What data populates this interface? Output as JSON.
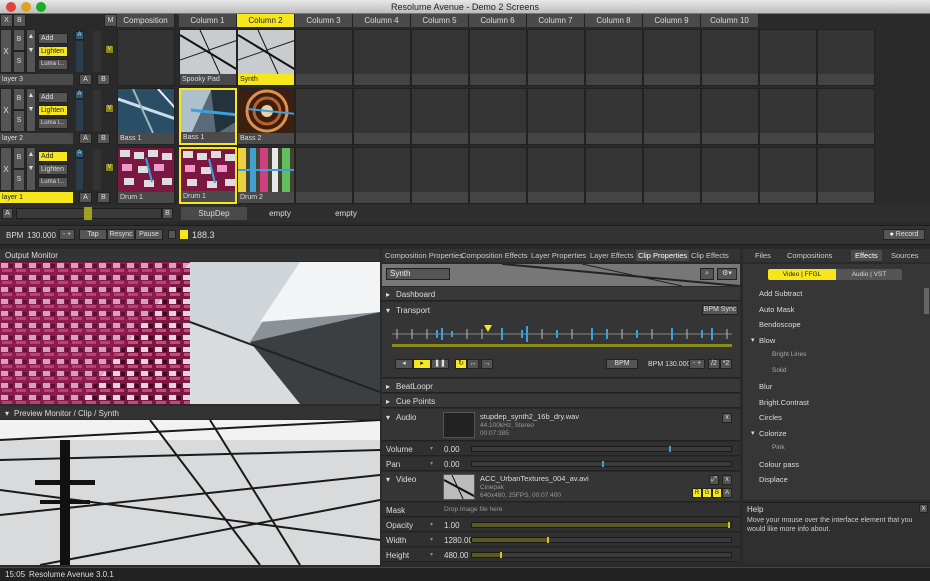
{
  "app": {
    "title": "Resolume Avenue - Demo 2 Screens"
  },
  "deck": {
    "x": "X",
    "b": "B",
    "m": "M",
    "composition": "Composition",
    "columns": [
      "Column 1",
      "Column 2",
      "Column 3",
      "Column 4",
      "Column 5",
      "Column 6",
      "Column 7",
      "Column 8",
      "Column 9",
      "Column 10"
    ],
    "layers": [
      {
        "name": "layer 3",
        "blend": "Add",
        "mode": "Lighten",
        "mask": "Luma l...",
        "clips": [
          "Spooky Pad",
          "Synth"
        ]
      },
      {
        "name": "layer 2",
        "blend": "Add",
        "mode": "Lighten",
        "mask": "Luma l...",
        "clips": [
          "Bass 1",
          "Bass 1",
          "Bass 2"
        ]
      },
      {
        "name": "layer 1",
        "blend": "Add",
        "mode": "Lighten",
        "mask": "Luma l...",
        "clips": [
          "Drum 1",
          "Drum 1",
          "Drum 2"
        ]
      }
    ],
    "s": "S",
    "a": "A",
    "v": "V",
    "crossfader": {
      "a": "A",
      "b": "B"
    },
    "decks": [
      "StupDep",
      "empty",
      "empty"
    ]
  },
  "transport_bar": {
    "bpm_label": "BPM",
    "bpm": "130.000",
    "minus_plus": "- +",
    "tap": "Tap",
    "resync": "Resync",
    "pause": "Pause",
    "counter": "188.3",
    "record": "Record"
  },
  "output_monitor": {
    "title": "Output Monitor"
  },
  "preview_monitor": {
    "title": "Preview Monitor / Clip / Synth"
  },
  "tabs": [
    "Composition Properties",
    "Composition Effects",
    "Layer Properties",
    "Layer Effects",
    "Clip Properties",
    "Clip Effects"
  ],
  "clip": {
    "name": "Synth",
    "sections": {
      "dashboard": "Dashboard",
      "transport": "Transport",
      "bpm_sync": "BPM Sync",
      "beatloopr": "BeatLoopr",
      "cue_points": "Cue Points",
      "audio": "Audio",
      "video": "Video"
    },
    "transport_mode": "BPM",
    "transport_bpm": "BPM 130.000",
    "half": "/2",
    "double": "*2",
    "audio_file": {
      "name": "stupdep_synth2_16b_dry.wav",
      "format": "44.100kHz, Stereo",
      "duration": "00:07:385"
    },
    "volume": {
      "label": "Volume",
      "value": "0.00"
    },
    "pan": {
      "label": "Pan",
      "value": "0.00"
    },
    "video_file": {
      "name": "ACC_UrbanTextures_004_av.avi",
      "codec": "Cinepak",
      "format": "640x480, 25FPS, 00:07:400"
    },
    "rgba": [
      "R",
      "G",
      "B",
      "A"
    ],
    "mask": {
      "label": "Mask",
      "placeholder": "Drop image file here"
    },
    "opacity": {
      "label": "Opacity",
      "value": "1.00",
      "fraction": 0.99
    },
    "width": {
      "label": "Width",
      "value": "1280.00",
      "fraction": 0.29
    },
    "height": {
      "label": "Height",
      "value": "480.00",
      "fraction": 0.11
    },
    "volume_fraction": 0.76,
    "pan_fraction": 0.5
  },
  "right_tabs": [
    "Files",
    "Compositions",
    "Effects",
    "Sources"
  ],
  "effects_sub": [
    "Video | FFGL",
    "Audio | VST"
  ],
  "effects": [
    "Add Subtract",
    "Auto Mask",
    "Bendoscope",
    "Blow",
    "Bright Lines",
    "Solid",
    "Blur",
    "Bright.Contrast",
    "Circles",
    "Colorize",
    "Pink",
    "Colour pass",
    "Displace"
  ],
  "help": {
    "title": "Help",
    "text": "Move your mouse over the interface element that you would like more info about.",
    "close": "x"
  },
  "status": {
    "time": "15:05",
    "version": "Resolume Avenue 3.0.1"
  }
}
